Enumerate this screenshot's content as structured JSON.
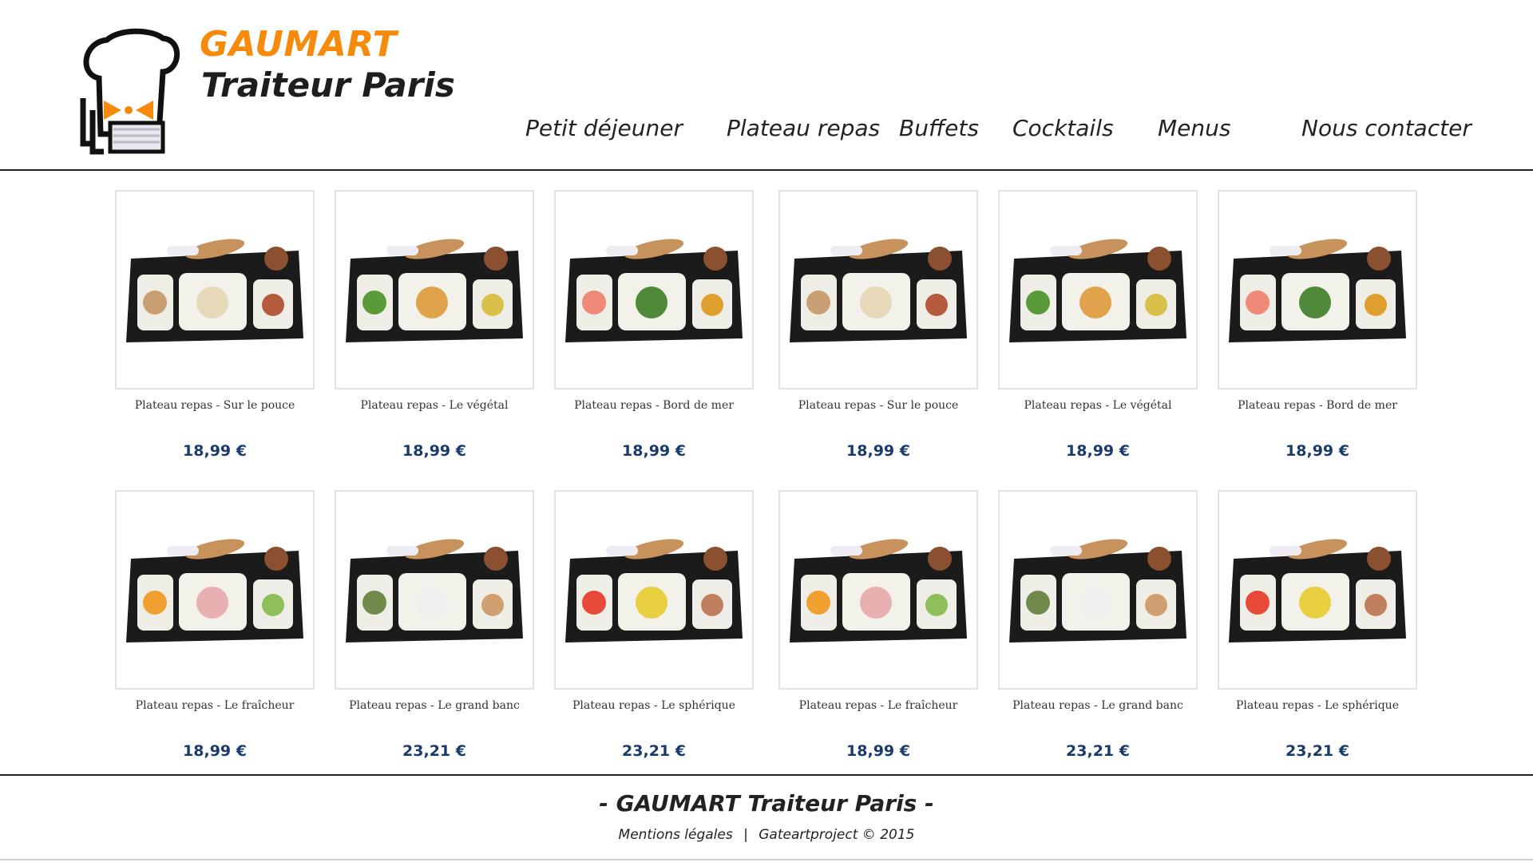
{
  "brand": {
    "name": "GAUMART",
    "subtitle": "Traiteur Paris"
  },
  "nav": {
    "items": [
      {
        "label": "Petit déjeuner"
      },
      {
        "label": "Plateau repas"
      },
      {
        "label": "Buffets"
      },
      {
        "label": "Cocktails"
      },
      {
        "label": "Menus"
      },
      {
        "label": "Nous contacter"
      }
    ]
  },
  "products": [
    {
      "title": "Plateau repas - Sur le pouce",
      "price": "18,99 €",
      "image": "tray-sur-le-pouce"
    },
    {
      "title": "Plateau repas - Le végétal",
      "price": "18,99 €",
      "image": "tray-le-vegetal"
    },
    {
      "title": "Plateau repas - Bord de mer",
      "price": "18,99 €",
      "image": "tray-bord-de-mer"
    },
    {
      "title": "Plateau repas - Sur le pouce",
      "price": "18,99 €",
      "image": "tray-sur-le-pouce"
    },
    {
      "title": "Plateau repas - Le végétal",
      "price": "18,99 €",
      "image": "tray-le-vegetal"
    },
    {
      "title": "Plateau repas - Bord de mer",
      "price": "18,99 €",
      "image": "tray-bord-de-mer"
    },
    {
      "title": "Plateau repas - Le fraîcheur",
      "price": "18,99 €",
      "image": "tray-le-fraicheur"
    },
    {
      "title": "Plateau repas - Le grand banc",
      "price": "23,21 €",
      "image": "tray-le-grand-banc"
    },
    {
      "title": "Plateau repas - Le sphérique",
      "price": "23,21 €",
      "image": "tray-le-spherique"
    },
    {
      "title": "Plateau repas - Le fraîcheur",
      "price": "18,99 €",
      "image": "tray-le-fraicheur"
    },
    {
      "title": "Plateau repas - Le grand banc",
      "price": "23,21 €",
      "image": "tray-le-grand-banc"
    },
    {
      "title": "Plateau repas - Le sphérique",
      "price": "23,21 €",
      "image": "tray-le-spherique"
    }
  ],
  "footer": {
    "title": "- GAUMART Traiteur Paris -",
    "legal_link": "Mentions légales",
    "separator": "|",
    "credit": "Gateartproject © 2015"
  },
  "colors": {
    "brand_orange": "#f58a0b",
    "price_blue": "#1a3a6b",
    "text_dark": "#222222"
  }
}
